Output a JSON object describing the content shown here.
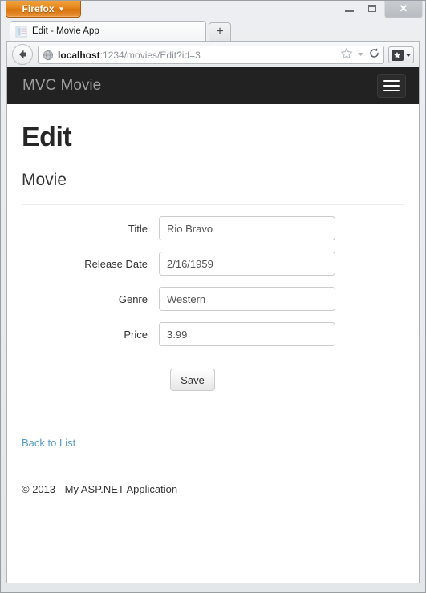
{
  "browser": {
    "app_button_label": "Firefox",
    "app_button_caret": "▼",
    "window_controls": {
      "minimize": "minimize-icon",
      "maximize": "maximize-icon",
      "close": "✕"
    },
    "tab": {
      "title": "Edit - Movie App",
      "favicon": "page-favicon"
    },
    "new_tab_label": "+",
    "back_arrow": "←",
    "url": {
      "host": "localhost",
      "path": ":1234/movies/Edit?id=3",
      "full": "localhost:1234/movies/Edit?id=3"
    },
    "url_icons": {
      "bookmark_star": "☆",
      "dropdown_caret": "▼",
      "reload": "⟳"
    },
    "bookmark_button": {
      "star": "★",
      "caret": "▼"
    }
  },
  "site": {
    "brand": "MVC Movie",
    "menu_toggle": "hamburger-menu"
  },
  "main": {
    "page_title": "Edit",
    "section_title": "Movie",
    "fields": [
      {
        "label": "Title",
        "value": "Rio Bravo",
        "name": "title"
      },
      {
        "label": "Release Date",
        "value": "2/16/1959",
        "name": "release-date"
      },
      {
        "label": "Genre",
        "value": "Western",
        "name": "genre"
      },
      {
        "label": "Price",
        "value": "3.99",
        "name": "price"
      }
    ],
    "save_button": "Save",
    "back_link": "Back to List"
  },
  "footer": {
    "text": "© 2013 - My ASP.NET Application"
  },
  "colors": {
    "navbar_bg": "#222222",
    "brand_text": "#9d9d9d",
    "link": "#5a9ec4",
    "firefox_orange": "#e5861d"
  }
}
